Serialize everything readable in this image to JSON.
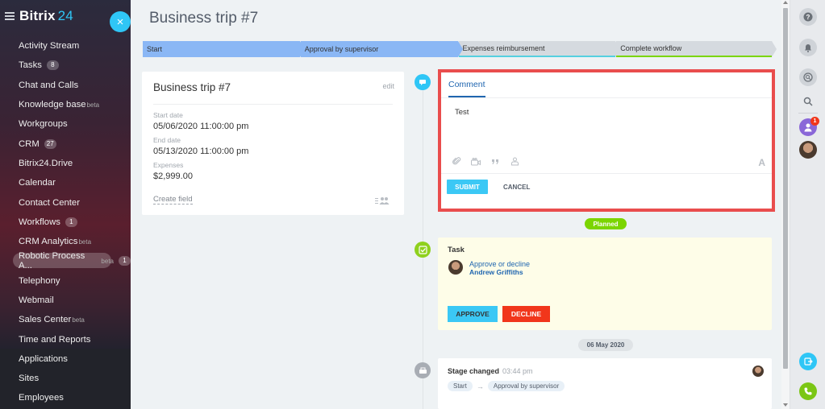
{
  "app": {
    "logo_name": "Bitrix",
    "logo_num": "24"
  },
  "sidebar": {
    "items": [
      {
        "label": "Activity Stream"
      },
      {
        "label": "Tasks",
        "counter": "8"
      },
      {
        "label": "Chat and Calls"
      },
      {
        "label": "Knowledge base",
        "sup": "beta"
      },
      {
        "label": "Workgroups"
      },
      {
        "label": "CRM",
        "counter": "27"
      },
      {
        "label": "Bitrix24.Drive"
      },
      {
        "label": "Calendar"
      },
      {
        "label": "Contact Center"
      },
      {
        "label": "Workflows",
        "counter": "1"
      },
      {
        "label": "CRM Analytics",
        "sup": "beta"
      },
      {
        "label": "Robotic Process A...",
        "sup": "beta",
        "counter": "1",
        "active": true
      },
      {
        "label": "Telephony"
      },
      {
        "label": "Webmail"
      },
      {
        "label": "Sales Center",
        "sup": "beta"
      },
      {
        "label": "Time and Reports"
      },
      {
        "label": "Applications"
      },
      {
        "label": "Sites"
      },
      {
        "label": "Employees"
      }
    ],
    "close_symbol": "×"
  },
  "page": {
    "title": "Business trip #7",
    "stages": [
      "Start",
      "Approval by supervisor",
      "Expenses reimbursement",
      "Complete workflow"
    ]
  },
  "details": {
    "title": "Business trip #7",
    "edit_label": "edit",
    "fields": [
      {
        "label": "Start date",
        "value": "05/06/2020 11:00:00 pm"
      },
      {
        "label": "End date",
        "value": "05/13/2020 11:00:00 pm"
      },
      {
        "label": "Expenses",
        "value": "$2,999.00"
      }
    ],
    "create_field_label": "Create field"
  },
  "comment": {
    "tab_label": "Comment",
    "text": "Test",
    "format_label": "A",
    "submit_label": "SUBMIT",
    "cancel_label": "CANCEL"
  },
  "timeline": {
    "planned_label": "Planned",
    "task": {
      "title": "Task",
      "link": "Approve or decline",
      "assignee": "Andrew Griffiths",
      "approve_label": "APPROVE",
      "decline_label": "DECLINE"
    },
    "date_label": "06 May 2020",
    "stage_change": {
      "title": "Stage changed",
      "time": "03:44 pm",
      "from": "Start",
      "arrow": "→",
      "to": "Approval by supervisor"
    }
  },
  "rightbar": {
    "notification_count": "1"
  },
  "colors": {
    "accent": "#2fc6f6",
    "planned": "#7bd500",
    "decline": "#f1361b",
    "highlight_border": "#e94d4d"
  },
  "icons": [
    "menu-icon",
    "close-icon",
    "users-icon",
    "comment-icon",
    "check-icon",
    "stage-icon",
    "help-icon",
    "bell-icon",
    "chat-search-icon",
    "search-icon",
    "user-icon",
    "phone-icon",
    "share-icon"
  ]
}
